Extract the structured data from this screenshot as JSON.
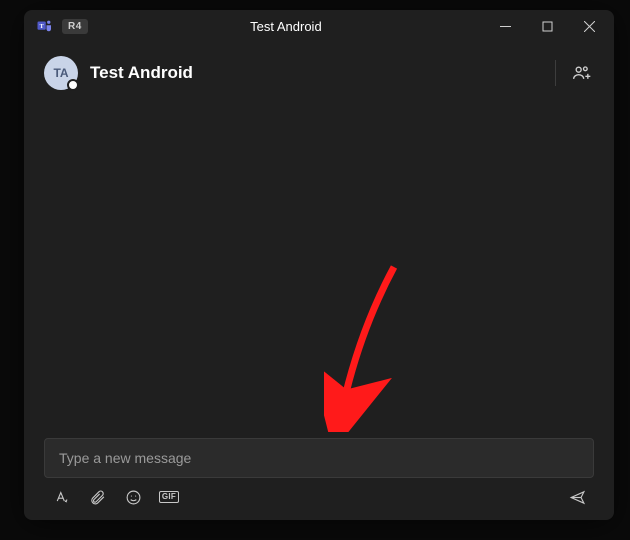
{
  "titlebar": {
    "badge": "R4",
    "title": "Test Android"
  },
  "header": {
    "avatar_initials": "TA",
    "chat_name": "Test Android"
  },
  "composer": {
    "placeholder": "Type a new message",
    "gif_label": "GIF"
  },
  "colors": {
    "arrow": "#ff1a1a"
  }
}
